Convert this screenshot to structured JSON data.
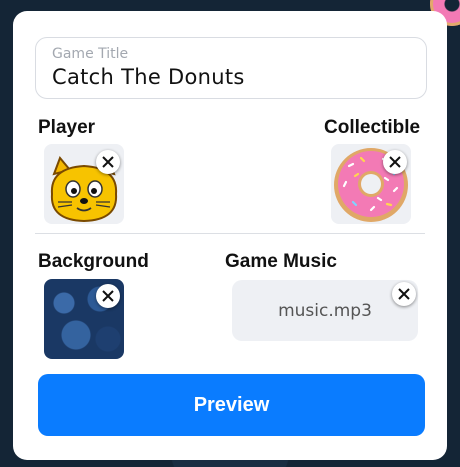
{
  "title_field": {
    "label": "Game Title",
    "value": "Catch The Donuts"
  },
  "player": {
    "label": "Player",
    "icon": "hamster-face-icon"
  },
  "collectible": {
    "label": "Collectible",
    "icon": "pink-donut-icon"
  },
  "background": {
    "label": "Background",
    "icon": "dark-blue-texture"
  },
  "music": {
    "label": "Game Music",
    "file": "music.mp3"
  },
  "preview": {
    "label": "Preview"
  },
  "colors": {
    "accent": "#0a7cff",
    "donut": "#f37ab5",
    "card": "#ffffff",
    "page_bg": "#142536"
  }
}
